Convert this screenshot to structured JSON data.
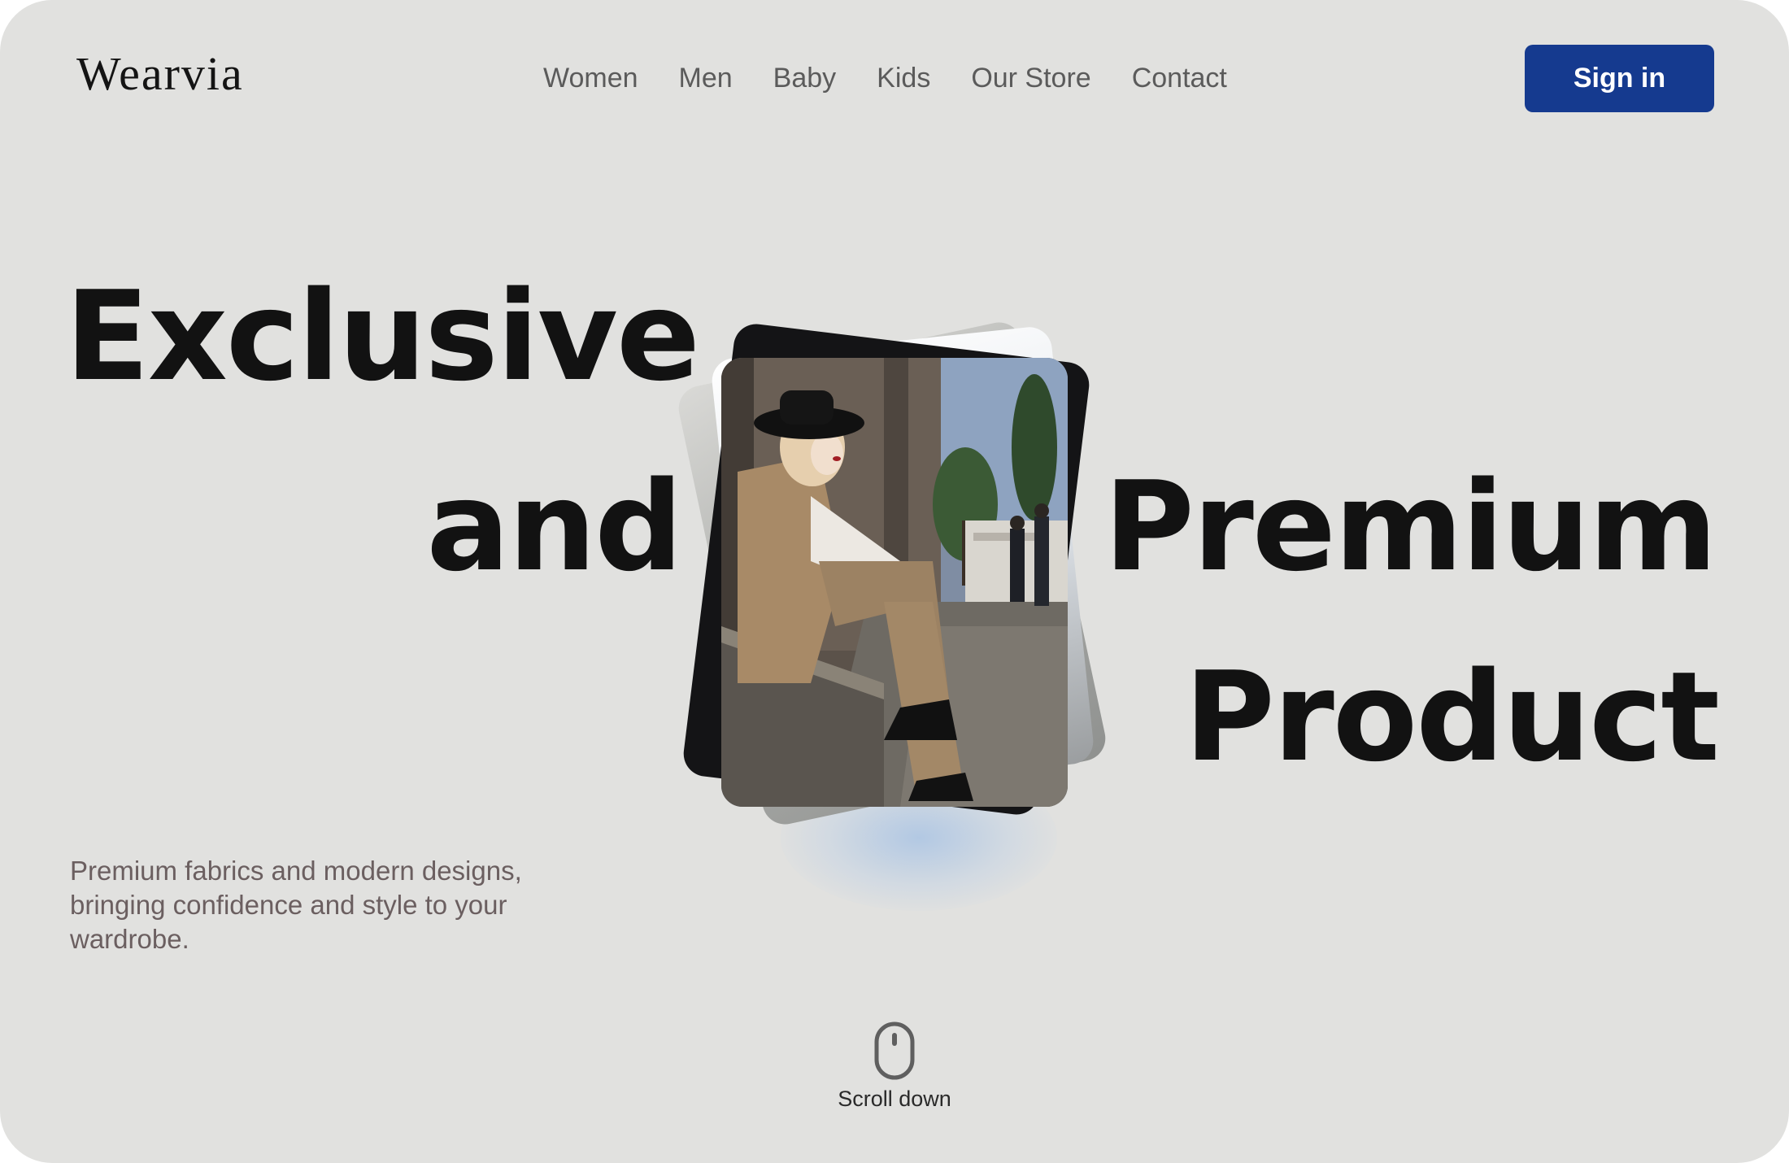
{
  "header": {
    "logo": "Wearvia",
    "nav": [
      "Women",
      "Men",
      "Baby",
      "Kids",
      "Our Store",
      "Contact"
    ],
    "sign_in_label": "Sign in"
  },
  "hero": {
    "headline": {
      "line1": "Exclusive",
      "line2a": "and",
      "line2b": "Premium",
      "line3": "Product"
    },
    "description": "Premium fabrics and modern designs, bringing confidence and style to your wardrobe.",
    "scroll_label": "Scroll down",
    "image": "fashion-model-photo"
  },
  "colors": {
    "background": "#e1e1df",
    "accent": "#153a8f",
    "headline": "#121212",
    "nav_text": "#5b5b5b",
    "description_text": "#6b5f60"
  },
  "icons": {
    "scroll": "mouse-icon"
  }
}
